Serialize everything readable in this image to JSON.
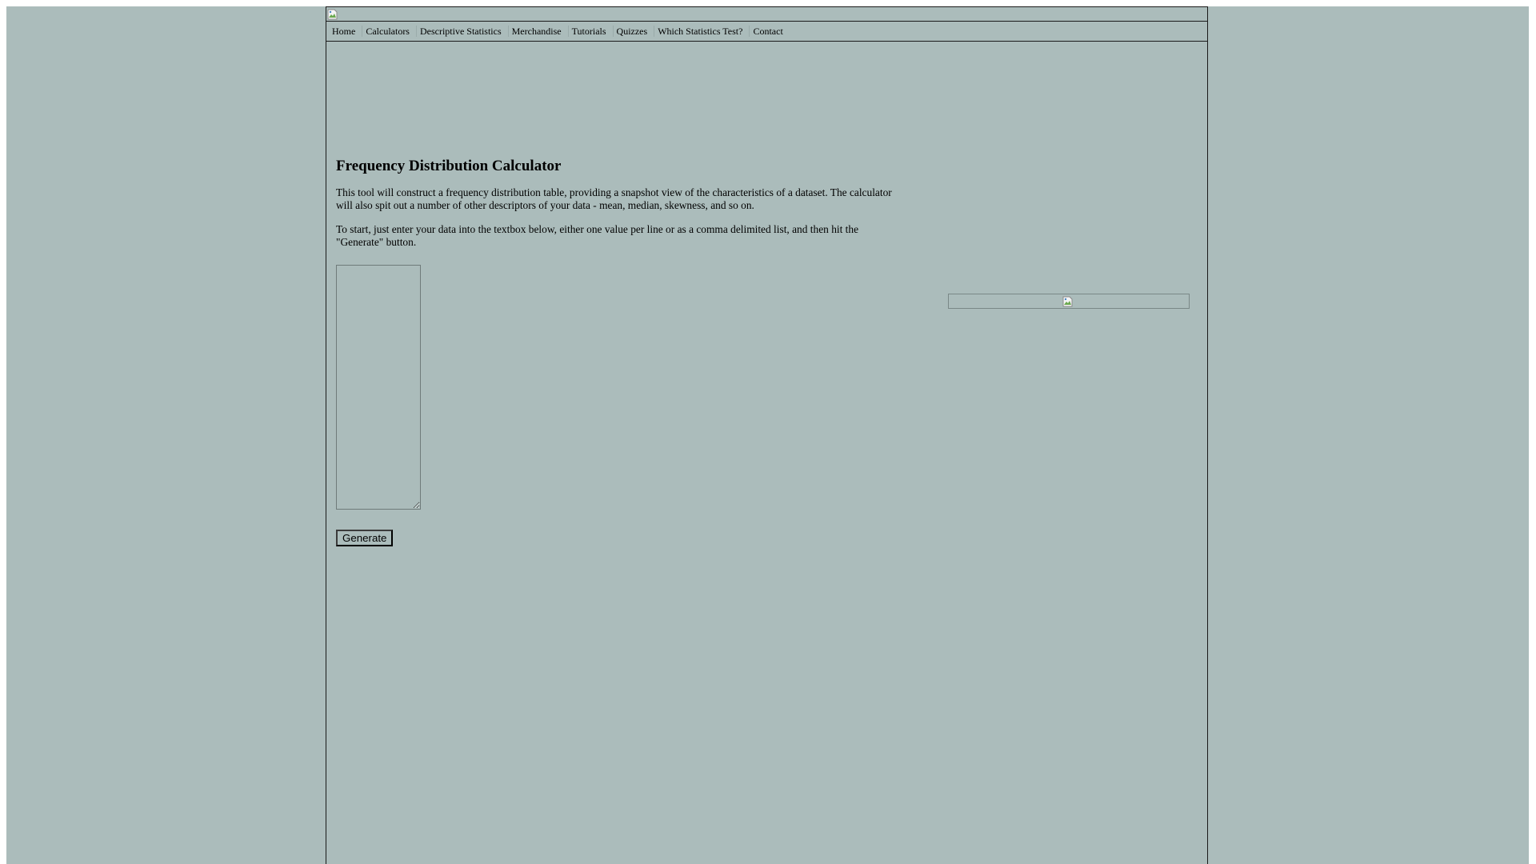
{
  "nav": {
    "items": [
      {
        "label": "Home"
      },
      {
        "label": "Calculators"
      },
      {
        "label": "Descriptive Statistics"
      },
      {
        "label": "Merchandise"
      },
      {
        "label": "Tutorials"
      },
      {
        "label": "Quizzes"
      },
      {
        "label": "Which Statistics Test?"
      },
      {
        "label": "Contact"
      }
    ]
  },
  "main": {
    "title": "Frequency Distribution Calculator",
    "paragraph_1": "This tool will construct a frequency distribution table, providing a snapshot view of the characteristics of a dataset. The calculator will also spit out a number of other descriptors of your data - mean, median, skewness, and so on.",
    "paragraph_2": "To start, just enter your data into the textbox below, either one value per line or as a comma delimited list, and then hit the \"Generate\" button.",
    "data_input_value": "",
    "generate_label": "Generate"
  },
  "icons": {
    "banner_image": "broken-image-icon",
    "ad_image": "broken-image-icon"
  },
  "colors": {
    "background": "#abbcbb",
    "border": "#1a1a1a"
  }
}
